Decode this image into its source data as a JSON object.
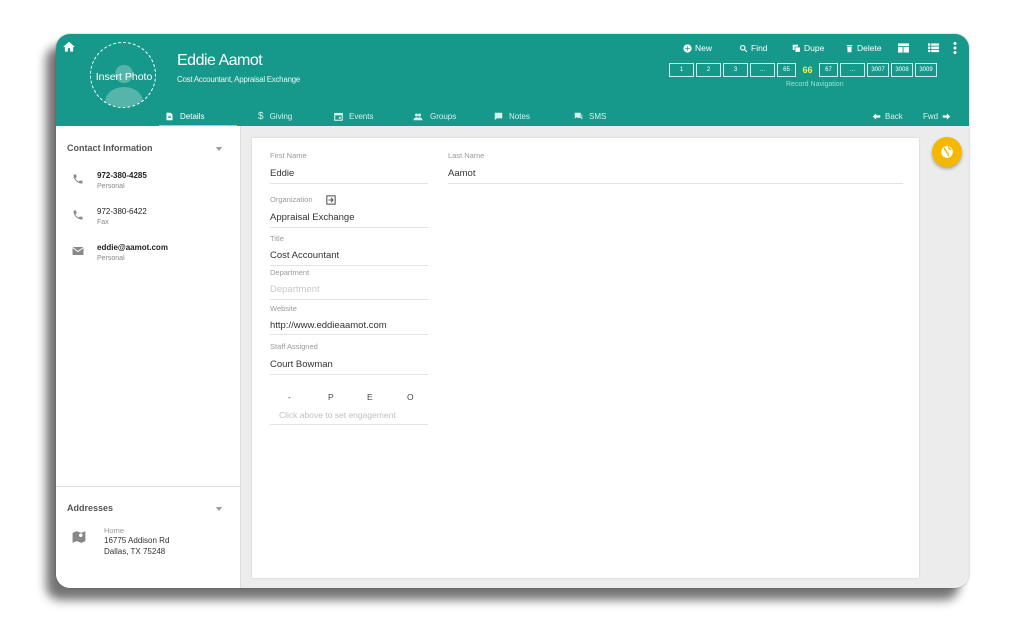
{
  "contact": {
    "name": "Eddie Aamot",
    "subtitle": "Cost Accountant, Appraisal Exchange",
    "photo_label": "Insert Photo"
  },
  "toolbar": {
    "new": "New",
    "find": "Find",
    "dupe": "Dupe",
    "delete": "Delete"
  },
  "pager": {
    "pages": [
      "1",
      "2",
      "3",
      "...",
      "65",
      "66",
      "67",
      "...",
      "3007",
      "3008",
      "3009"
    ],
    "current": "66",
    "label": "Record Navigation"
  },
  "tabs": [
    {
      "label": "Details",
      "icon": "document-icon"
    },
    {
      "label": "Giving",
      "icon": "dollar-icon"
    },
    {
      "label": "Events",
      "icon": "calendar-icon"
    },
    {
      "label": "Groups",
      "icon": "people-icon"
    },
    {
      "label": "Notes",
      "icon": "comment-icon"
    },
    {
      "label": "SMS",
      "icon": "chat-icon"
    }
  ],
  "nav": {
    "back": "Back",
    "fwd": "Fwd"
  },
  "sidebar": {
    "contact_title": "Contact Information",
    "phones": [
      {
        "value": "972-380-4285",
        "label": "Personal"
      },
      {
        "value": "972-380-6422",
        "label": "Fax"
      }
    ],
    "email": {
      "value": "eddie@aamot.com",
      "label": "Personal"
    },
    "addresses_title": "Addresses",
    "address": {
      "type": "Home",
      "line1": "16775 Addison Rd",
      "line2": "Dallas, TX 75248"
    }
  },
  "form": {
    "first_name_label": "First Name",
    "first_name": "Eddie",
    "last_name_label": "Last Name",
    "last_name": "Aamot",
    "organization_label": "Organization",
    "organization": "Appraisal Exchange",
    "title_label": "Title",
    "title": "Cost Accountant",
    "department_label": "Department",
    "department_placeholder": "Department",
    "website_label": "Website",
    "website": "http://www.eddieaamot.com",
    "staff_label": "Staff Assigned",
    "staff": "Court Bowman",
    "engagement": [
      "-",
      "P",
      "E",
      "O"
    ],
    "engagement_hint": "Click above to set engagement"
  },
  "colors": {
    "header": "#16998a",
    "accent": "#ffc107",
    "fab": "#f5b800"
  }
}
